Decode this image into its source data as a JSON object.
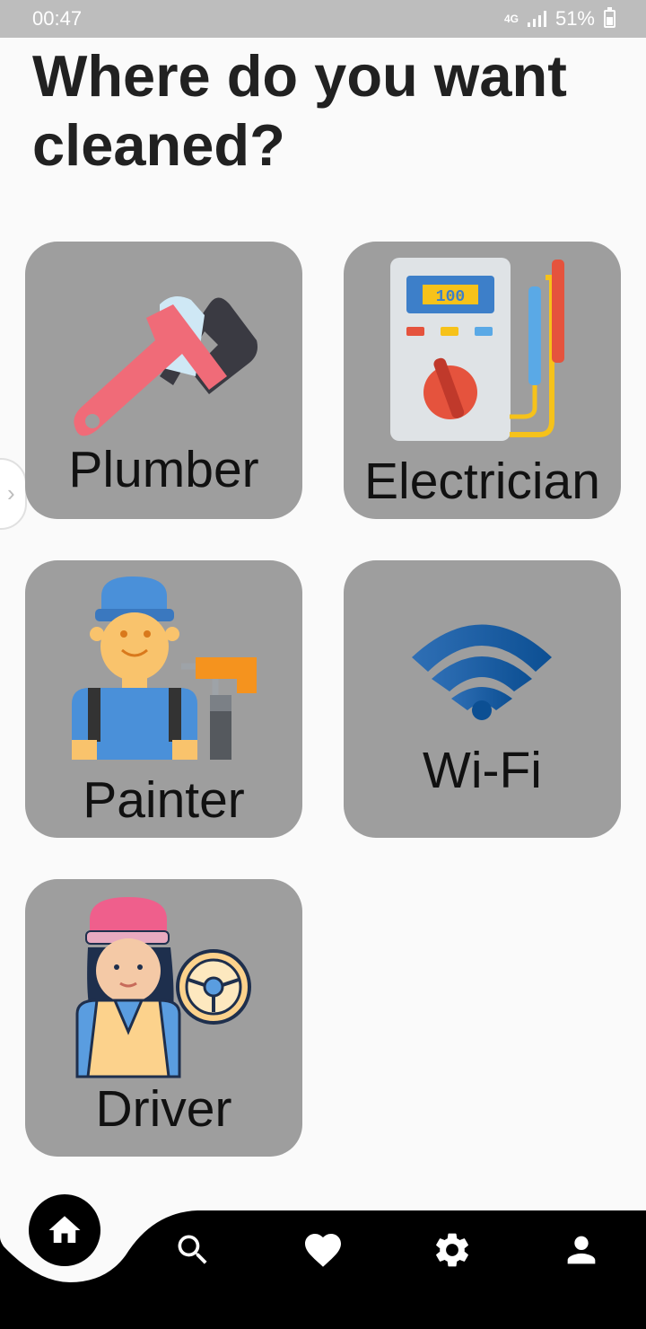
{
  "status_bar": {
    "time": "00:47",
    "network": "4G",
    "battery": "51%"
  },
  "title": "Where do you want cleaned?",
  "services": [
    {
      "label": "Plumber",
      "icon": "plumber-wrench-icon"
    },
    {
      "label": "Electrician",
      "icon": "multimeter-icon",
      "display": "100"
    },
    {
      "label": "Painter",
      "icon": "painter-icon"
    },
    {
      "label": "Wi-Fi",
      "icon": "wifi-icon"
    },
    {
      "label": "Driver",
      "icon": "driver-icon"
    }
  ],
  "bottom_nav": [
    {
      "name": "home",
      "icon": "home-icon",
      "active": true
    },
    {
      "name": "search",
      "icon": "search-icon"
    },
    {
      "name": "favorites",
      "icon": "heart-icon"
    },
    {
      "name": "settings",
      "icon": "gear-icon"
    },
    {
      "name": "profile",
      "icon": "person-icon"
    }
  ],
  "colors": {
    "tile": "#9e9e9e",
    "background": "#fafafa",
    "nav": "#000000"
  }
}
